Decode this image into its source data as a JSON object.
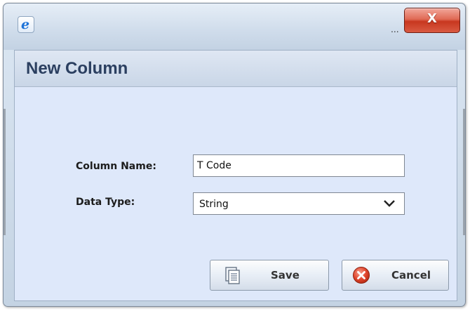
{
  "window": {
    "app_icon_glyph": "e",
    "ellipsis": "...",
    "close_glyph": "X",
    "close_color": "#d5432a"
  },
  "dialog": {
    "title": "New Column",
    "accent_color": "#2b3f60",
    "background_color": "#dee8fa"
  },
  "form": {
    "column_name": {
      "label": "Column Name:",
      "value": "T Code"
    },
    "data_type": {
      "label": "Data Type:",
      "selected": "String",
      "icon": "chevron-down-icon"
    }
  },
  "buttons": {
    "save": {
      "label": "Save",
      "icon": "save-document-icon"
    },
    "cancel": {
      "label": "Cancel",
      "icon": "cancel-x-icon",
      "icon_color": "#e0442b"
    }
  }
}
